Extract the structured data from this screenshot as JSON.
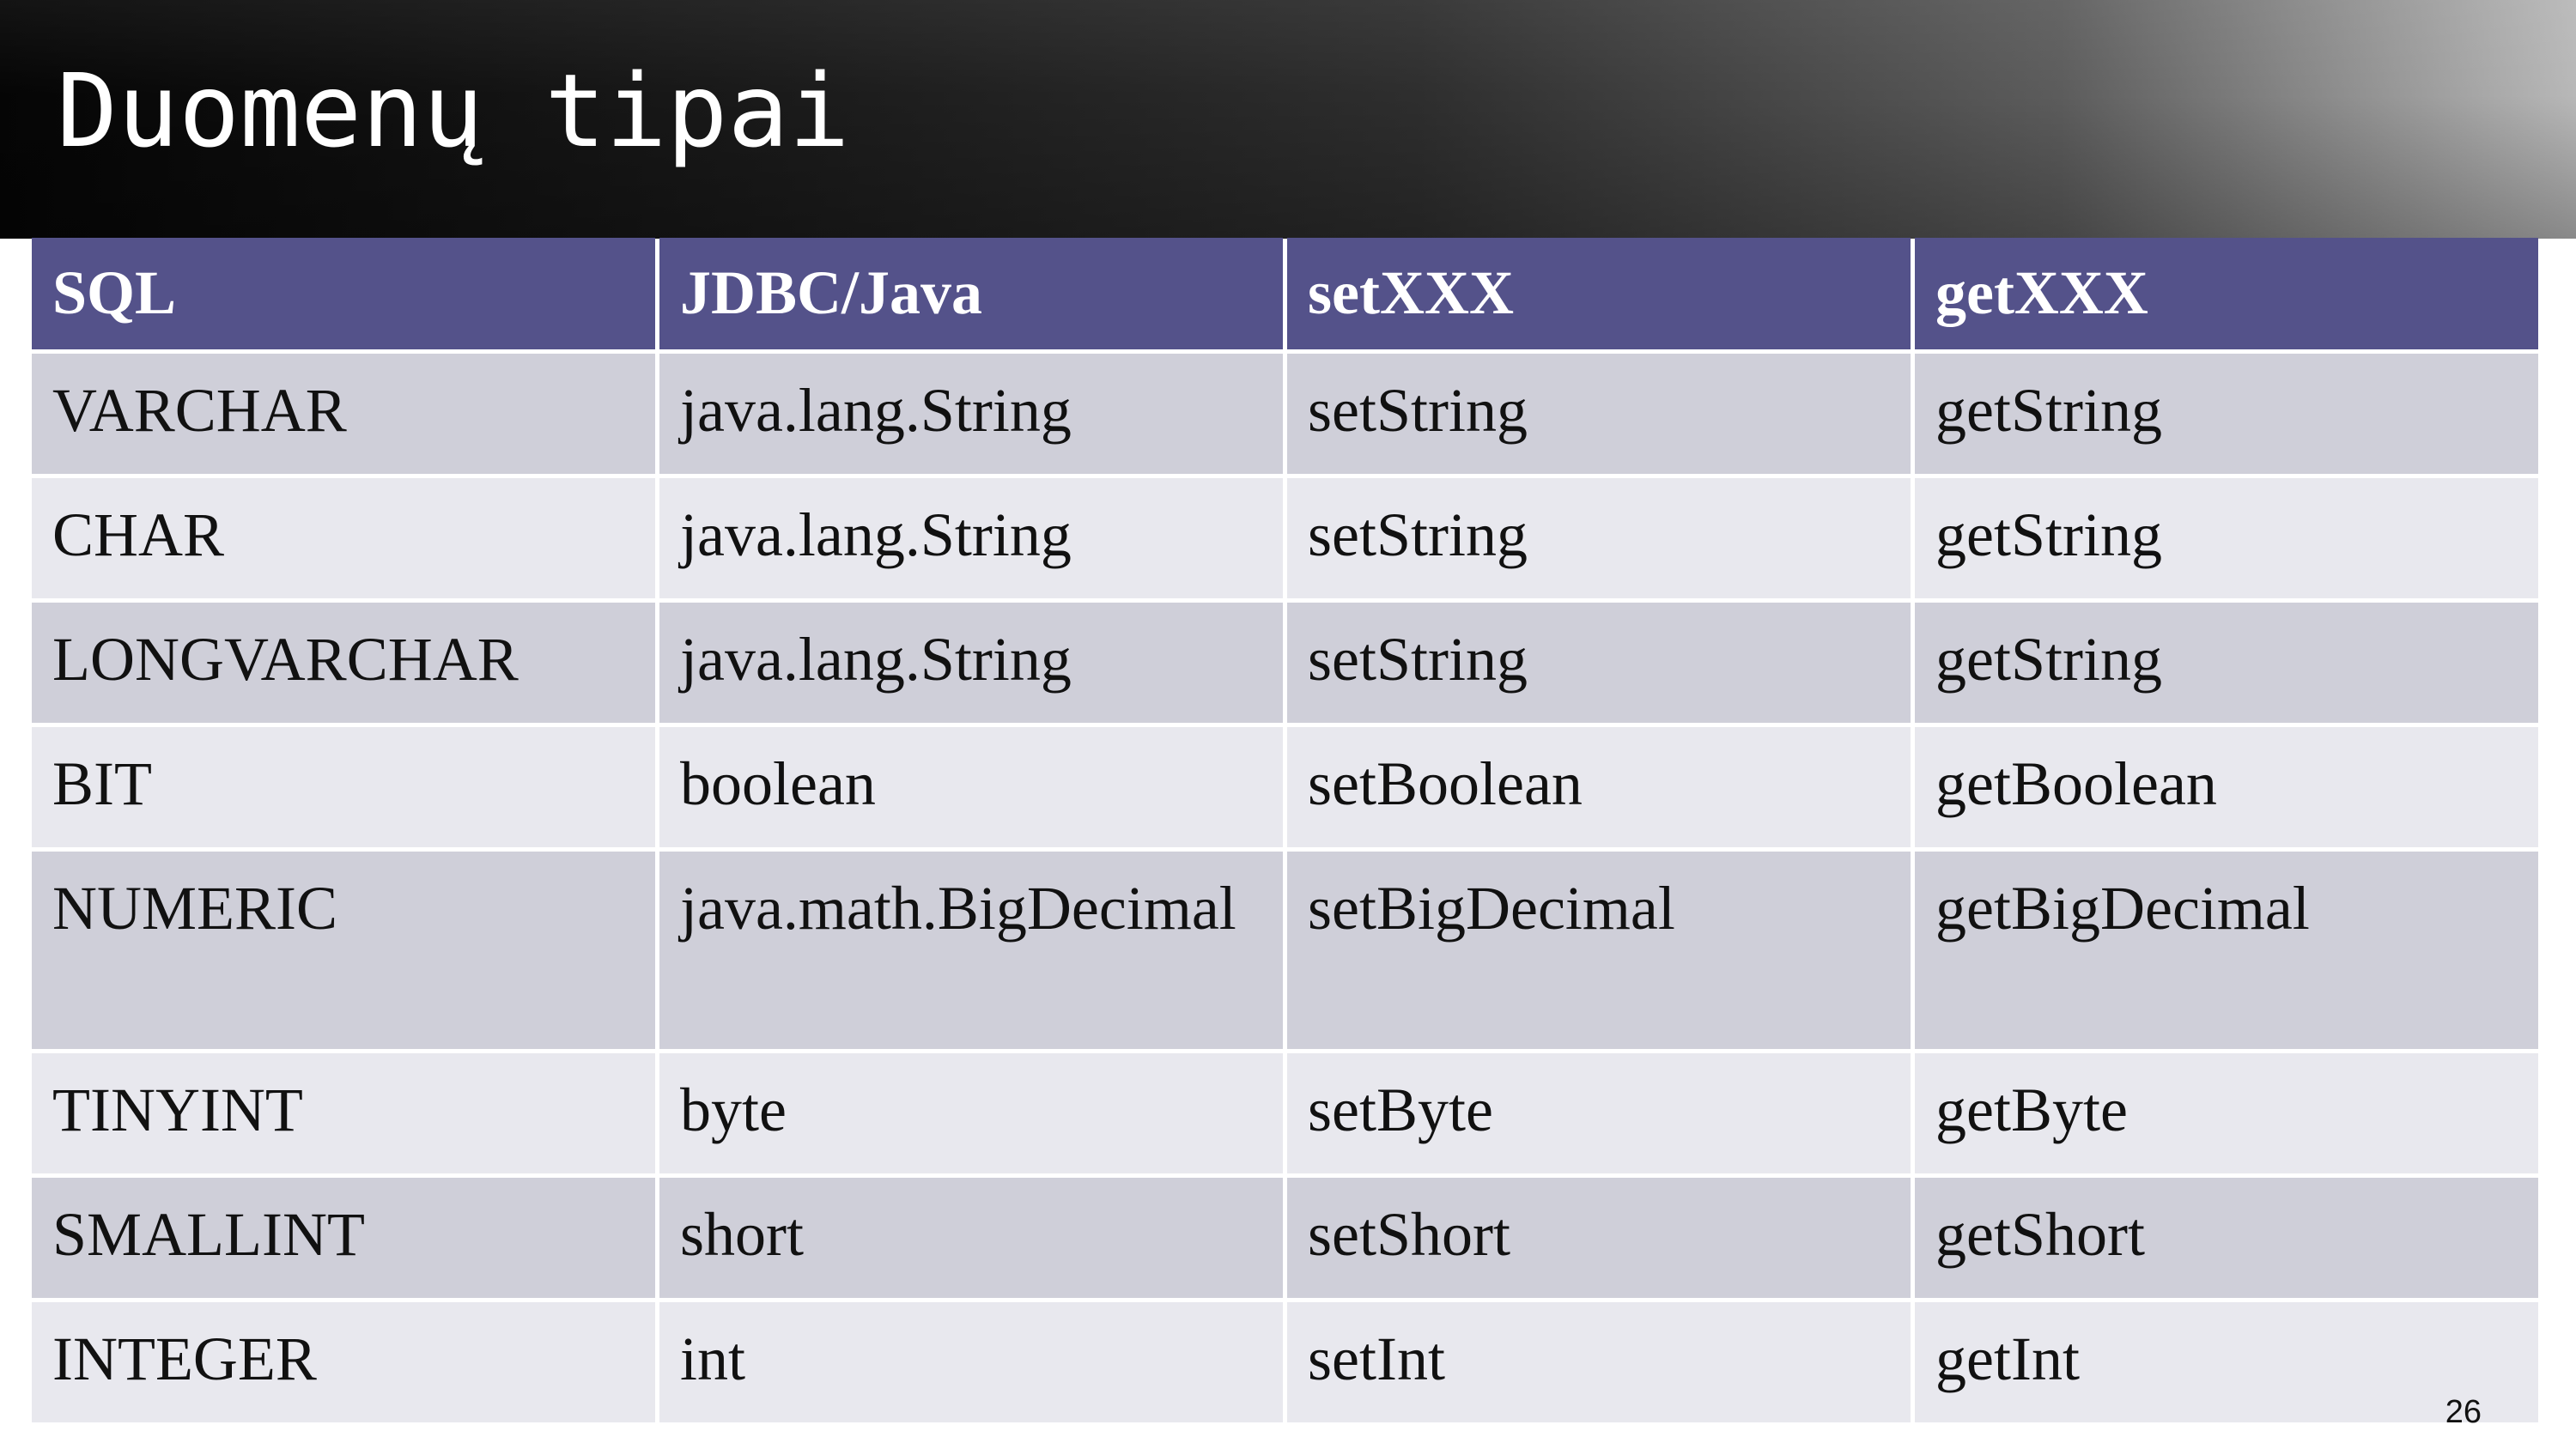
{
  "slide": {
    "title": "Duomenų tipai",
    "page_number": "26"
  },
  "table": {
    "headers": [
      "SQL",
      "JDBC/Java",
      "setXXX",
      "getXXX"
    ],
    "rows": [
      [
        "VARCHAR",
        "java.lang.String",
        "setString",
        "getString"
      ],
      [
        "CHAR",
        "java.lang.String",
        "setString",
        "getString"
      ],
      [
        "LONGVARCHAR",
        "java.lang.String",
        "setString",
        "getString"
      ],
      [
        "BIT",
        "boolean",
        "setBoolean",
        "getBoolean"
      ],
      [
        "NUMERIC",
        "java.math.BigDecimal",
        "setBigDecimal",
        "getBigDecimal"
      ],
      [
        "TINYINT",
        "byte",
        "setByte",
        "getByte"
      ],
      [
        "SMALLINT",
        "short",
        "setShort",
        "getShort"
      ],
      [
        "INTEGER",
        "int",
        "setInt",
        "getInt"
      ]
    ]
  },
  "colors": {
    "header_bg": "#54528a",
    "row_dark": "#cfcfd9",
    "row_light": "#e8e8ee",
    "title_bar": "#050505"
  }
}
